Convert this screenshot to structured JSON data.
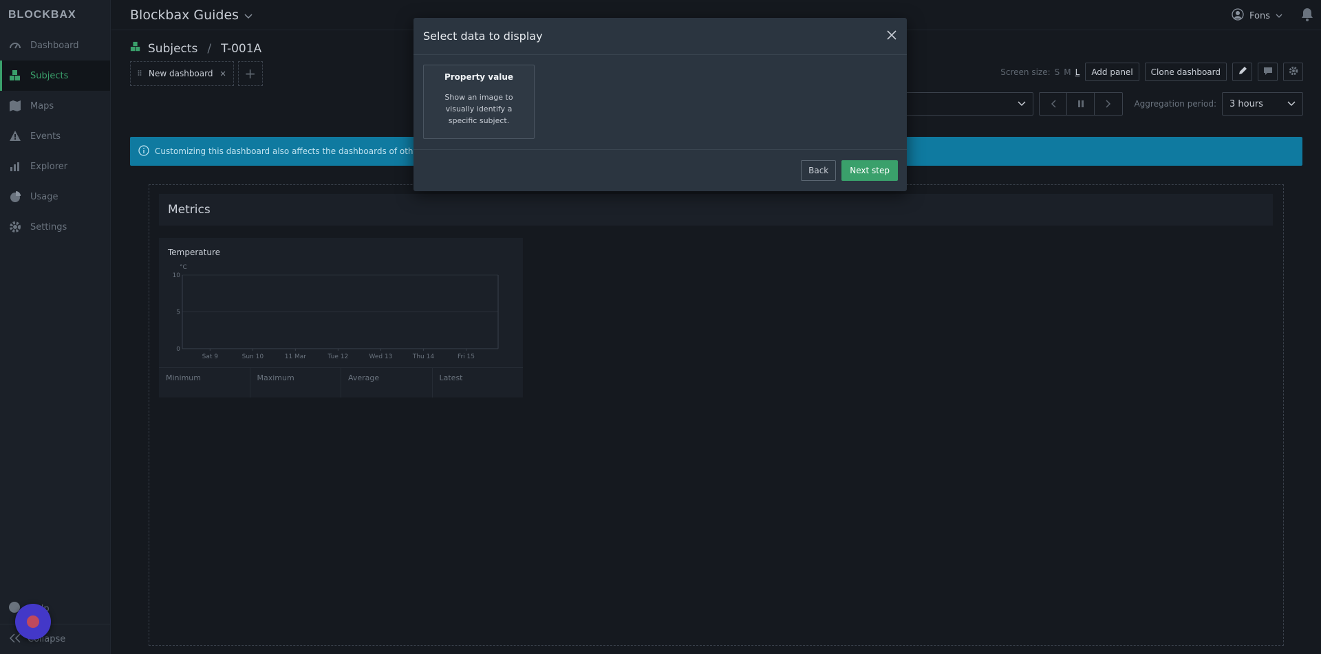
{
  "sidebar": {
    "logo": "BLOCKBAX",
    "items": [
      {
        "label": "Dashboard",
        "icon": "dashboard-icon"
      },
      {
        "label": "Subjects",
        "icon": "subjects-icon"
      },
      {
        "label": "Maps",
        "icon": "maps-icon"
      },
      {
        "label": "Events",
        "icon": "warning-icon"
      },
      {
        "label": "Explorer",
        "icon": "explorer-icon"
      },
      {
        "label": "Usage",
        "icon": "pie-icon"
      },
      {
        "label": "Settings",
        "icon": "gear-icon"
      }
    ],
    "active_index": 1,
    "help_label": "Help",
    "collapse_label": "Collapse"
  },
  "header": {
    "app_title": "Blockbax Guides",
    "user_name": "Fons"
  },
  "breadcrumb": {
    "section": "Subjects",
    "subject": "T-001A"
  },
  "tabs": [
    {
      "label": "New dashboard"
    }
  ],
  "toolbar": {
    "screen_size_label": "Screen size:",
    "sizes": [
      "S",
      "M",
      "L"
    ],
    "selected_size": "L",
    "add_panel": "Add panel",
    "clone_dashboard": "Clone dashboard"
  },
  "filters": {
    "aggregation_label": "Aggregation period:",
    "aggregation_value": "3 hours"
  },
  "banner": {
    "text": "Customizing this dashboard also affects the dashboards of other s"
  },
  "dashboard": {
    "section_title": "Metrics",
    "panel": {
      "title": "Temperature",
      "stats": [
        "Minimum",
        "Maximum",
        "Average",
        "Latest"
      ]
    }
  },
  "chart_data": {
    "type": "line",
    "title": "Temperature",
    "ylabel": "°C",
    "ylim": [
      0,
      10
    ],
    "yticks": [
      "10",
      "5",
      "0"
    ],
    "categories": [
      "Sat 9",
      "Sun 10",
      "11 Mar",
      "Tue 12",
      "Wed 13",
      "Thu 14",
      "Fri 15"
    ],
    "series": [],
    "grid": true
  },
  "modal": {
    "title": "Select data to display",
    "card": {
      "title": "Property value",
      "description": "Show an image to visually identify a specific subject."
    },
    "back_label": "Back",
    "next_label": "Next step"
  },
  "colors": {
    "accent": "#3aa06b",
    "banner": "#0f7aa0",
    "fab": "#4338c8"
  }
}
